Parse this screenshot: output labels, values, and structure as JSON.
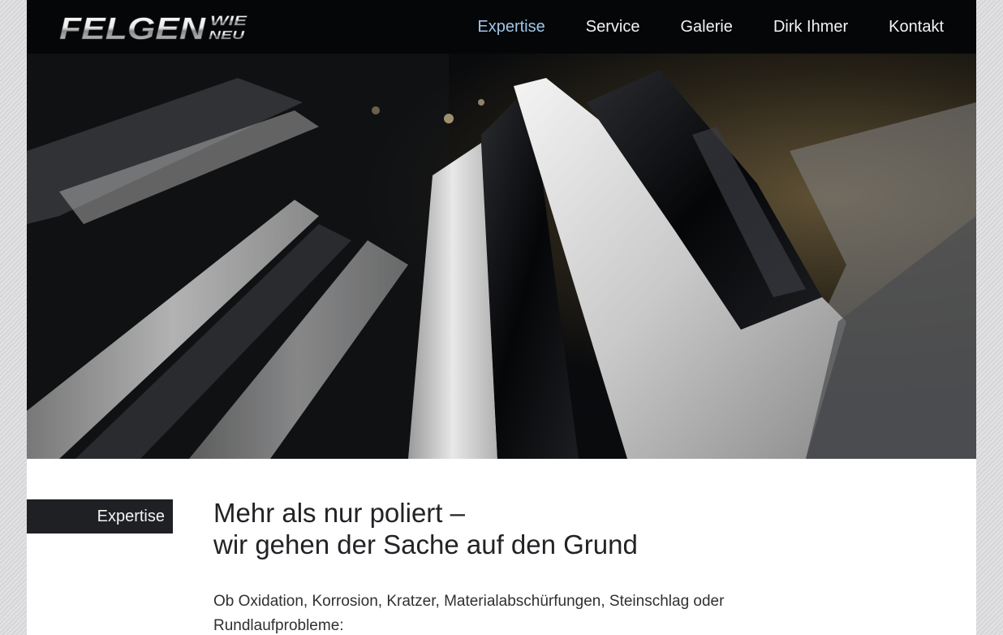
{
  "header": {
    "logo": {
      "main_text": "FELGEN",
      "sub_text_top": "WIE",
      "sub_text_bottom": "NEU"
    },
    "nav": [
      {
        "label": "Expertise",
        "active": true
      },
      {
        "label": "Service",
        "active": false
      },
      {
        "label": "Galerie",
        "active": false
      },
      {
        "label": "Dirk Ihmer",
        "active": false
      },
      {
        "label": "Kontakt",
        "active": false
      }
    ],
    "colors": {
      "background": "#050608",
      "nav_text": "#f2f2f2",
      "nav_active": "#9ec6e8"
    }
  },
  "hero": {
    "image_subject": "close-up of a polished black and silver alloy wheel rim"
  },
  "content": {
    "section_label": "Expertise",
    "headline_line1": "Mehr als nur poliert –",
    "headline_line2": "wir gehen der Sache auf den Grund",
    "intro_text": "Ob Oxidation, Korrosion, Kratzer, Materialabschürfungen, Steinschlag oder Rundlaufprobleme:"
  }
}
